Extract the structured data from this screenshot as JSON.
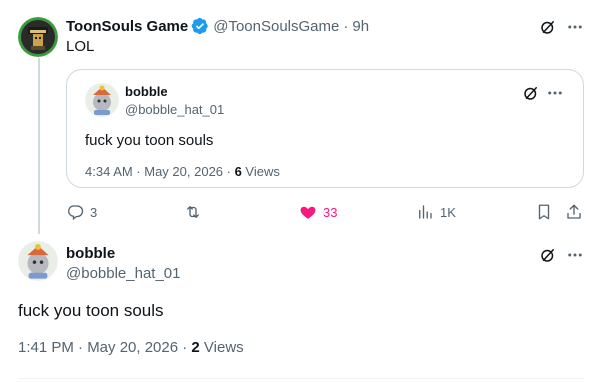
{
  "main_post": {
    "display_name": "ToonSouls Game",
    "handle": "@ToonSoulsGame",
    "separator": "·",
    "time": "9h",
    "text": "LOL"
  },
  "quoted_post": {
    "display_name": "bobble",
    "handle": "@bobble_hat_01",
    "text": "fuck you toon souls",
    "timestamp": "4:34 AM · May 20, 2026 · ",
    "views_count": "6",
    "views_label": " Views"
  },
  "actions": {
    "replies": "3",
    "reposts": "",
    "likes": "33",
    "views": "1K"
  },
  "reply_post": {
    "display_name": "bobble",
    "handle": "@bobble_hat_01",
    "text": "fuck you toon souls",
    "timestamp": "1:41 PM · May 20, 2026 · ",
    "views_count": "2",
    "views_label": " Views"
  },
  "colors": {
    "verified_blue": "#1d9bf0",
    "like_pink": "#f91880",
    "muted_text": "#536471",
    "border": "#cfd9de"
  },
  "icons": {
    "verified": "verified-badge-icon",
    "grok": "grok-icon",
    "more": "more-dots-icon",
    "reply": "reply-icon",
    "repost": "repost-icon",
    "like": "heart-filled-icon",
    "views": "views-bar-chart-icon",
    "bookmark": "bookmark-icon",
    "share": "share-icon"
  }
}
